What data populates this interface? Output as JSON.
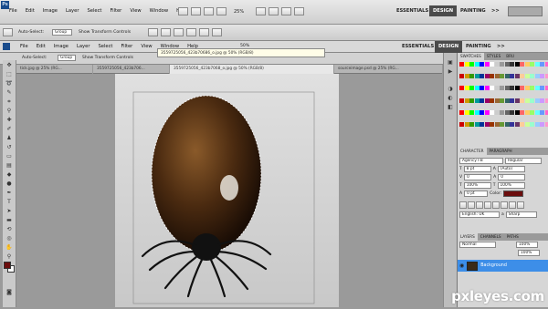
{
  "app": {
    "logo": "Ps"
  },
  "menu": [
    "File",
    "Edit",
    "Image",
    "Layer",
    "Select",
    "Filter",
    "View",
    "Window",
    "Help"
  ],
  "zoom": "25%",
  "zoom2": "50%",
  "workspace": {
    "essentials": "ESSENTIALS",
    "design": "DESIGN",
    "painting": "PAINTING",
    "more": ">>"
  },
  "options": {
    "auto_select": "Auto-Select:",
    "group": "Group",
    "show_transform": "Show Transform Controls"
  },
  "tabs": [
    "tick.jpg @ 25% (RG...",
    "3559725056_423b706...",
    "3559725056_423b7068_o.jpg @ 50% (RGB/8)",
    "sourceimage.psd @ 25% (RG..."
  ],
  "tooltip": "3559725056_423b70686_o.jpg @ 50% (RGB/8)",
  "swatches": {
    "tabs": [
      "SWATCHES",
      "STYLES",
      "BRU"
    ],
    "colors": [
      "#ff0000",
      "#ffff00",
      "#00ff00",
      "#00ffff",
      "#0000ff",
      "#ff00ff",
      "#ffffff",
      "#cccccc",
      "#999999",
      "#666666",
      "#333333",
      "#000000",
      "#ff6666",
      "#ffcc66",
      "#99ff66",
      "#66ffff",
      "#6699ff",
      "#ff66cc",
      "#cc0000",
      "#cc9900",
      "#339900",
      "#009999",
      "#003399",
      "#990066",
      "#993300",
      "#996633",
      "#669933",
      "#336666",
      "#333399",
      "#663366",
      "#ffcc99",
      "#ccff99",
      "#99ffcc",
      "#99ccff",
      "#cc99ff",
      "#ff99cc"
    ]
  },
  "character": {
    "tabs": [
      "CHARACTER",
      "PARAGRAPH"
    ],
    "font": "Agency FB",
    "style": "Regular",
    "size": "8 pt",
    "leading": "(Auto)",
    "kerning": "0",
    "tracking": "0",
    "vscale": "100%",
    "hscale": "100%",
    "baseline": "0 pt",
    "color_label": "Color:",
    "language": "English: UK",
    "aa": "Sharp"
  },
  "layers": {
    "tabs": [
      "LAYERS",
      "CHANNELS",
      "PATHS"
    ],
    "blend": "Normal",
    "opacity": "100%",
    "layer_name": "Background"
  },
  "watermark": "pxleyes.com",
  "colors": {
    "fg": "#6b0d0d",
    "highlight": "#3d8ee8",
    "tick_body": "#5a3a1c"
  }
}
